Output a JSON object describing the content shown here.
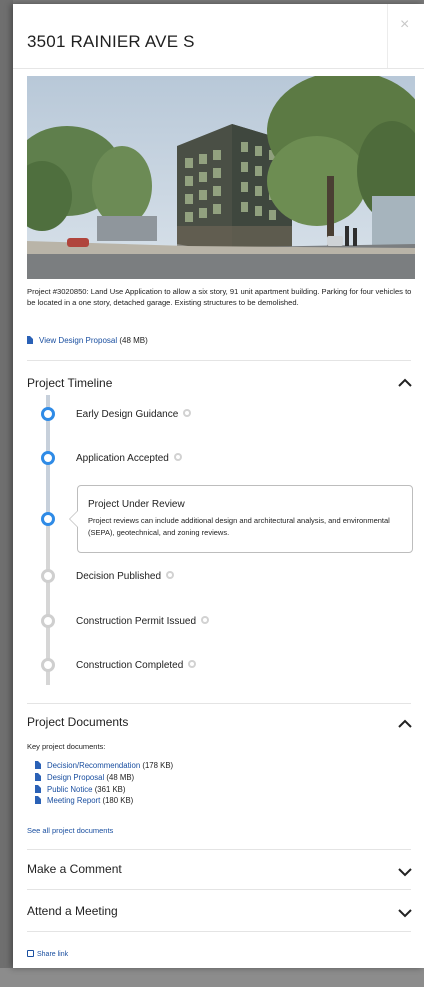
{
  "header": {
    "title": "3501 RAINIER AVE S",
    "close_glyph": "×"
  },
  "project": {
    "description": "Project #3020850: Land Use Application to allow a six story, 91 unit apartment building. Parking for four vehicles to be located in a one story, detached garage. Existing structures to be demolished.",
    "design_link": {
      "label": "View Design Proposal",
      "size": "(48 MB)"
    }
  },
  "timeline": {
    "title": "Project Timeline",
    "steps": [
      {
        "label": "Early Design Guidance",
        "status": "done"
      },
      {
        "label": "Application Accepted",
        "status": "done"
      },
      {
        "label": "Project Under Review",
        "status": "current",
        "detail": "Project reviews can include additional design and architectural analysis, and environmental (SEPA), geotechnical, and zoning reviews."
      },
      {
        "label": "Decision Published",
        "status": "pending"
      },
      {
        "label": "Construction Permit Issued",
        "status": "pending"
      },
      {
        "label": "Construction Completed",
        "status": "pending"
      }
    ]
  },
  "documents": {
    "title": "Project Documents",
    "intro": "Key project documents:",
    "items": [
      {
        "label": "Decision/Recommendation",
        "size": "(178 KB)"
      },
      {
        "label": "Design Proposal",
        "size": "(48 MB)"
      },
      {
        "label": "Public Notice",
        "size": "(361 KB)"
      },
      {
        "label": "Meeting Report",
        "size": "(180 KB)"
      }
    ],
    "see_all": "See all project documents"
  },
  "sections": {
    "comment": "Make a Comment",
    "meeting": "Attend a Meeting"
  },
  "share": {
    "label": "Share link"
  },
  "colors": {
    "accent": "#2f8be6",
    "link": "#1a4fa0"
  }
}
